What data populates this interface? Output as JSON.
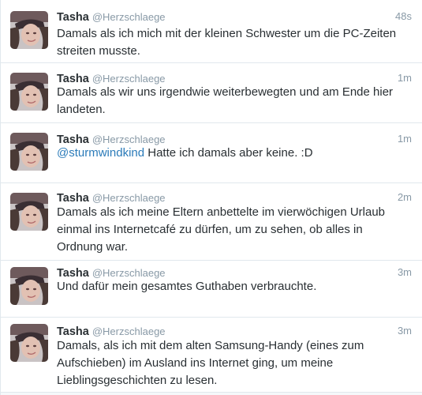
{
  "tweets": [
    {
      "name": "Tasha",
      "handle": "@Herzschlaege",
      "time": "48s",
      "mention": "",
      "text": "Damals als ich mich mit der kleinen Schwester um die PC-Zeiten streiten musste."
    },
    {
      "name": "Tasha",
      "handle": "@Herzschlaege",
      "time": "1m",
      "mention": "",
      "text": "Damals als wir uns irgendwie weiterbewegten und am Ende hier landeten."
    },
    {
      "name": "Tasha",
      "handle": "@Herzschlaege",
      "time": "1m",
      "mention": "@sturmwindkind",
      "text": " Hatte ich damals aber keine. :D"
    },
    {
      "name": "Tasha",
      "handle": "@Herzschlaege",
      "time": "2m",
      "mention": "",
      "text": "Damals als ich meine Eltern anbettelte im vierwöchigen Urlaub einmal ins Internetcafé zu dürfen, um zu sehen, ob alles in Ordnung war."
    },
    {
      "name": "Tasha",
      "handle": "@Herzschlaege",
      "time": "3m",
      "mention": "",
      "text": "Und dafür mein gesamtes Guthaben verbrauchte."
    },
    {
      "name": "Tasha",
      "handle": "@Herzschlaege",
      "time": "3m",
      "mention": "",
      "text": "Damals, als ich mit dem alten Samsung-Handy (eines zum Aufschieben) im Ausland ins Internet ging, um meine Lieblingsgeschichten zu lesen."
    }
  ],
  "colors": {
    "name": "#292f33",
    "meta": "#8899a6",
    "mention": "#2b7bb9",
    "divider": "#e1e8ed"
  }
}
